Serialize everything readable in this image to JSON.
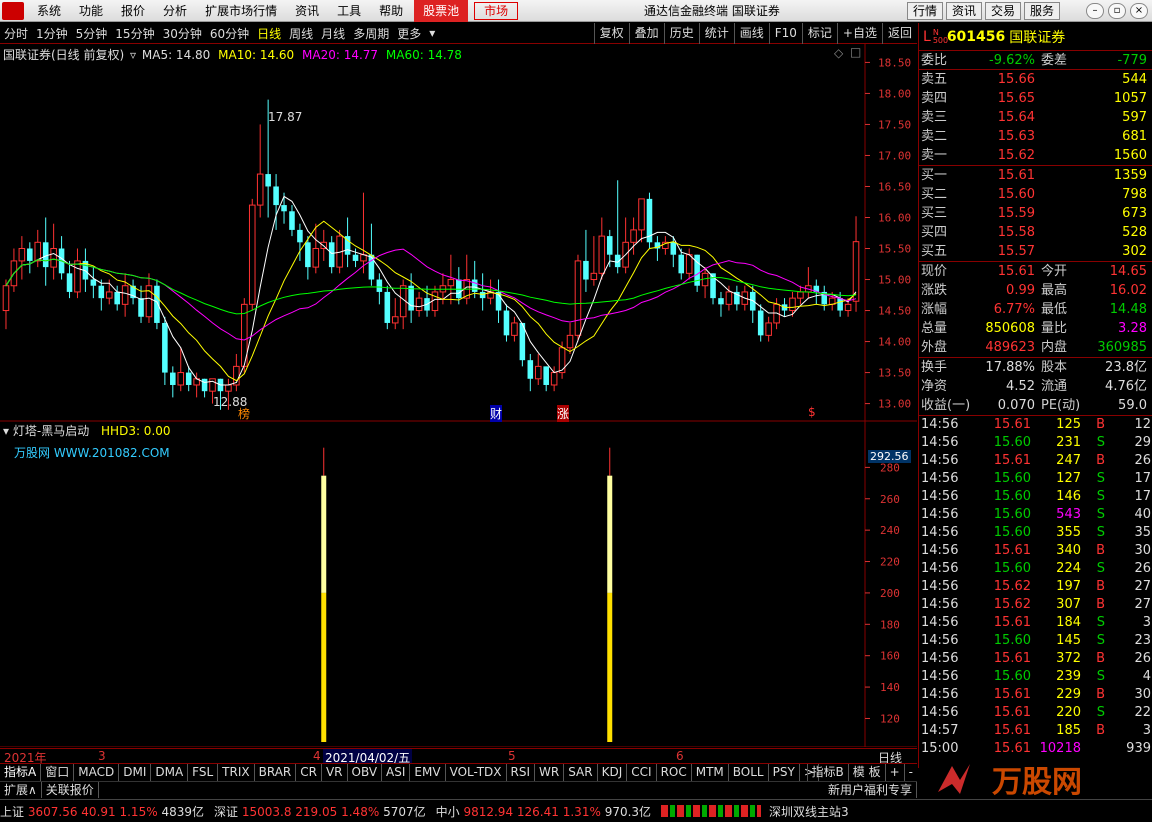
{
  "menu": [
    "系统",
    "功能",
    "报价",
    "分析",
    "扩展市场行情",
    "资讯",
    "工具",
    "帮助"
  ],
  "menu_hot": "股票池",
  "menu_market": "市场",
  "window_title": "通达信金融终端  国联证券",
  "right_buttons": [
    "行情",
    "资讯",
    "交易",
    "服务"
  ],
  "periods": [
    "分时",
    "1分钟",
    "5分钟",
    "15分钟",
    "30分钟",
    "60分钟",
    "日线",
    "周线",
    "月线",
    "多周期",
    "更多"
  ],
  "active_period": "日线",
  "tools": [
    "复权",
    "叠加",
    "历史",
    "统计",
    "画线",
    "F10",
    "标记",
    "+自选",
    "返回"
  ],
  "chart_header": {
    "name": "国联证券(日线 前复权)",
    "ma5": "MA5: 14.80",
    "ma10": "MA10: 14.60",
    "ma20": "MA20: 14.77",
    "ma60": "MA60: 14.78"
  },
  "annotations": {
    "high": "17.87",
    "low": "12.88"
  },
  "markers": [
    "榜",
    "财",
    "涨",
    "$"
  ],
  "indicator_header": {
    "name": "灯塔-黑马启动",
    "value": "HHD3: 0.00",
    "site": "万股网 WWW.201082.COM"
  },
  "indicator_current": "292.56",
  "x_labels": [
    "2021年",
    "3",
    "4",
    "5",
    "6"
  ],
  "cursor_date": "2021/04/02/五",
  "period_tag": "日线",
  "tabs": [
    "指标A",
    "窗口",
    "MACD",
    "DMI",
    "DMA",
    "FSL",
    "TRIX",
    "BRAR",
    "CR",
    "VR",
    "OBV",
    "ASI",
    "EMV",
    "VOL-TDX",
    "RSI",
    "WR",
    "SAR",
    "KDJ",
    "CCI",
    "ROC",
    "MTM",
    "BOLL",
    "PSY",
    ">"
  ],
  "tabs_right": [
    "指标B",
    "模 板",
    "+",
    "-"
  ],
  "ext_left": [
    "扩展∧",
    "关联报价"
  ],
  "ext_right": [
    "新用户福利专享"
  ],
  "stock": {
    "prefix": "L",
    "badge": "N 500",
    "code": "601456",
    "name": "国联证券"
  },
  "weibi": {
    "label": "委比",
    "value": "-9.62%",
    "label2": "委差",
    "value2": "-779"
  },
  "asks": [
    {
      "label": "卖五",
      "price": "15.66",
      "vol": "544"
    },
    {
      "label": "卖四",
      "price": "15.65",
      "vol": "1057"
    },
    {
      "label": "卖三",
      "price": "15.64",
      "vol": "597"
    },
    {
      "label": "卖二",
      "price": "15.63",
      "vol": "681"
    },
    {
      "label": "卖一",
      "price": "15.62",
      "vol": "1560"
    }
  ],
  "bids": [
    {
      "label": "买一",
      "price": "15.61",
      "vol": "1359"
    },
    {
      "label": "买二",
      "price": "15.60",
      "vol": "798"
    },
    {
      "label": "买三",
      "price": "15.59",
      "vol": "673"
    },
    {
      "label": "买四",
      "price": "15.58",
      "vol": "528"
    },
    {
      "label": "买五",
      "price": "15.57",
      "vol": "302"
    }
  ],
  "stats": [
    {
      "l1": "现价",
      "v1": "15.61",
      "l2": "今开",
      "v2": "14.65",
      "c1": "red",
      "c2": "red"
    },
    {
      "l1": "涨跌",
      "v1": "0.99",
      "l2": "最高",
      "v2": "16.02",
      "c1": "red",
      "c2": "red"
    },
    {
      "l1": "涨幅",
      "v1": "6.77%",
      "l2": "最低",
      "v2": "14.48",
      "c1": "red",
      "c2": "green"
    },
    {
      "l1": "总量",
      "v1": "850608",
      "l2": "量比",
      "v2": "3.28",
      "c1": "yellow",
      "c2": "mag"
    },
    {
      "l1": "外盘",
      "v1": "489623",
      "l2": "内盘",
      "v2": "360985",
      "c1": "red",
      "c2": "green"
    }
  ],
  "stats2": [
    {
      "l1": "换手",
      "v1": "17.88%",
      "l2": "股本",
      "v2": "23.8亿"
    },
    {
      "l1": "净资",
      "v1": "4.52",
      "l2": "流通",
      "v2": "4.76亿"
    },
    {
      "l1": "收益(一)",
      "v1": "0.070",
      "l2": "PE(动)",
      "v2": "59.0"
    }
  ],
  "ticks": [
    {
      "t": "14:56",
      "p": "15.61",
      "v": "125",
      "d": "B",
      "n": "12"
    },
    {
      "t": "14:56",
      "p": "15.60",
      "v": "231",
      "d": "S",
      "n": "29"
    },
    {
      "t": "14:56",
      "p": "15.61",
      "v": "247",
      "d": "B",
      "n": "26"
    },
    {
      "t": "14:56",
      "p": "15.60",
      "v": "127",
      "d": "S",
      "n": "17"
    },
    {
      "t": "14:56",
      "p": "15.60",
      "v": "146",
      "d": "S",
      "n": "17"
    },
    {
      "t": "14:56",
      "p": "15.60",
      "v": "543",
      "d": "S",
      "n": "40"
    },
    {
      "t": "14:56",
      "p": "15.60",
      "v": "355",
      "d": "S",
      "n": "35"
    },
    {
      "t": "14:56",
      "p": "15.61",
      "v": "340",
      "d": "B",
      "n": "30"
    },
    {
      "t": "14:56",
      "p": "15.60",
      "v": "224",
      "d": "S",
      "n": "26"
    },
    {
      "t": "14:56",
      "p": "15.62",
      "v": "197",
      "d": "B",
      "n": "27"
    },
    {
      "t": "14:56",
      "p": "15.62",
      "v": "307",
      "d": "B",
      "n": "27"
    },
    {
      "t": "14:56",
      "p": "15.61",
      "v": "184",
      "d": "S",
      "n": "3"
    },
    {
      "t": "14:56",
      "p": "15.60",
      "v": "145",
      "d": "S",
      "n": "23"
    },
    {
      "t": "14:56",
      "p": "15.61",
      "v": "372",
      "d": "B",
      "n": "26"
    },
    {
      "t": "14:56",
      "p": "15.60",
      "v": "239",
      "d": "S",
      "n": "4"
    },
    {
      "t": "14:56",
      "p": "15.61",
      "v": "229",
      "d": "B",
      "n": "30"
    },
    {
      "t": "14:56",
      "p": "15.61",
      "v": "220",
      "d": "S",
      "n": "22"
    },
    {
      "t": "14:57",
      "p": "15.61",
      "v": "185",
      "d": "B",
      "n": "3"
    },
    {
      "t": "15:00",
      "p": "15.61",
      "v": "10218",
      "d": "",
      "n": "939"
    }
  ],
  "status": [
    {
      "name": "上证",
      "v": "3607.56",
      "c": "40.91",
      "p": "1.15%",
      "a": "4839亿"
    },
    {
      "name": "深证",
      "v": "15003.8",
      "c": "219.05",
      "p": "1.48%",
      "a": "5707亿"
    },
    {
      "name": "中小",
      "v": "9812.94",
      "c": "126.41",
      "p": "1.31%",
      "a": "970.3亿"
    }
  ],
  "status_site": "深圳双线主站3",
  "watermark": "万股网",
  "chart_data": [
    {
      "type": "candlestick",
      "y_ticks": [
        13.0,
        13.5,
        14.0,
        14.5,
        15.0,
        15.5,
        16.0,
        16.5,
        17.0,
        17.5,
        18.0,
        18.5
      ],
      "ylim": [
        12.8,
        18.7
      ],
      "candles": [
        [
          14.5,
          14.9,
          14.2,
          15.0
        ],
        [
          14.9,
          15.3,
          14.8,
          15.5
        ],
        [
          15.3,
          15.5,
          15.0,
          15.7
        ],
        [
          15.5,
          15.3,
          15.1,
          15.6
        ],
        [
          15.3,
          15.6,
          15.2,
          15.8
        ],
        [
          15.6,
          15.2,
          14.9,
          16.0
        ],
        [
          15.2,
          15.5,
          15.0,
          15.9
        ],
        [
          15.5,
          15.1,
          15.0,
          15.7
        ],
        [
          15.1,
          14.8,
          14.7,
          15.3
        ],
        [
          14.8,
          15.3,
          14.7,
          15.5
        ],
        [
          15.3,
          15.0,
          14.8,
          15.5
        ],
        [
          15.0,
          14.9,
          14.7,
          15.2
        ],
        [
          14.9,
          14.7,
          14.5,
          15.0
        ],
        [
          14.7,
          14.8,
          14.6,
          15.0
        ],
        [
          14.8,
          14.6,
          14.5,
          14.9
        ],
        [
          14.6,
          14.9,
          14.4,
          15.1
        ],
        [
          14.9,
          14.7,
          14.6,
          15.0
        ],
        [
          14.7,
          14.4,
          14.3,
          14.9
        ],
        [
          14.4,
          14.9,
          14.3,
          15.1
        ],
        [
          14.9,
          14.3,
          14.2,
          15.0
        ],
        [
          14.3,
          13.5,
          13.3,
          14.4
        ],
        [
          13.5,
          13.3,
          13.1,
          13.6
        ],
        [
          13.3,
          13.5,
          13.2,
          13.9
        ],
        [
          13.5,
          13.3,
          13.2,
          13.6
        ],
        [
          13.3,
          13.4,
          13.1,
          13.5
        ],
        [
          13.4,
          13.2,
          13.1,
          13.4
        ],
        [
          13.2,
          13.4,
          13.0,
          13.4
        ],
        [
          13.4,
          13.2,
          12.9,
          13.4
        ],
        [
          13.2,
          13.3,
          12.9,
          13.4
        ],
        [
          13.3,
          13.6,
          13.2,
          13.8
        ],
        [
          13.6,
          14.6,
          13.5,
          14.7
        ],
        [
          14.6,
          16.2,
          14.5,
          16.3
        ],
        [
          16.2,
          16.7,
          16.0,
          17.5
        ],
        [
          16.7,
          16.5,
          16.0,
          17.9
        ],
        [
          16.5,
          16.2,
          15.8,
          16.7
        ],
        [
          16.2,
          16.1,
          15.9,
          16.4
        ],
        [
          16.1,
          15.8,
          15.7,
          16.2
        ],
        [
          15.8,
          15.6,
          15.3,
          15.9
        ],
        [
          15.6,
          15.2,
          15.0,
          15.7
        ],
        [
          15.2,
          15.5,
          15.1,
          15.9
        ],
        [
          15.5,
          15.6,
          15.3,
          15.8
        ],
        [
          15.6,
          15.2,
          15.1,
          15.7
        ],
        [
          15.2,
          15.7,
          15.1,
          15.8
        ],
        [
          15.7,
          15.4,
          15.2,
          16.0
        ],
        [
          15.4,
          15.3,
          15.2,
          15.5
        ],
        [
          15.3,
          15.4,
          15.1,
          16.4
        ],
        [
          15.4,
          15.0,
          14.9,
          15.9
        ],
        [
          15.0,
          14.8,
          14.6,
          15.1
        ],
        [
          14.8,
          14.3,
          14.2,
          14.9
        ],
        [
          14.3,
          14.4,
          14.2,
          14.7
        ],
        [
          14.4,
          14.9,
          14.2,
          15.0
        ],
        [
          14.9,
          14.5,
          14.3,
          15.1
        ],
        [
          14.5,
          14.7,
          14.4,
          14.8
        ],
        [
          14.7,
          14.5,
          14.4,
          14.9
        ],
        [
          14.5,
          14.8,
          14.4,
          14.9
        ],
        [
          14.8,
          14.9,
          14.6,
          15.1
        ],
        [
          14.9,
          15.0,
          14.6,
          15.4
        ],
        [
          15.0,
          14.7,
          14.6,
          15.2
        ],
        [
          14.7,
          15.0,
          14.6,
          15.4
        ],
        [
          15.0,
          14.8,
          14.7,
          15.3
        ],
        [
          14.8,
          14.7,
          14.5,
          15.1
        ],
        [
          14.7,
          14.8,
          14.6,
          15.0
        ],
        [
          14.8,
          14.5,
          14.3,
          15.0
        ],
        [
          14.5,
          14.1,
          14.0,
          14.6
        ],
        [
          14.1,
          14.3,
          14.0,
          14.4
        ],
        [
          14.3,
          13.7,
          13.6,
          14.3
        ],
        [
          13.7,
          13.4,
          13.2,
          13.8
        ],
        [
          13.4,
          13.6,
          13.3,
          13.8
        ],
        [
          13.6,
          13.3,
          13.2,
          13.6
        ],
        [
          13.3,
          13.5,
          13.2,
          13.6
        ],
        [
          13.5,
          13.9,
          13.4,
          14.0
        ],
        [
          13.9,
          14.1,
          13.8,
          14.3
        ],
        [
          14.1,
          15.3,
          14.0,
          15.4
        ],
        [
          15.3,
          15.0,
          14.8,
          15.8
        ],
        [
          15.0,
          15.1,
          14.9,
          15.7
        ],
        [
          15.1,
          15.7,
          15.0,
          16.0
        ],
        [
          15.7,
          15.4,
          15.2,
          15.8
        ],
        [
          15.4,
          15.2,
          15.1,
          16.6
        ],
        [
          15.2,
          15.6,
          15.1,
          16.0
        ],
        [
          15.6,
          15.8,
          15.4,
          16.0
        ],
        [
          15.8,
          16.3,
          15.6,
          16.3
        ],
        [
          16.3,
          15.6,
          15.5,
          16.4
        ],
        [
          15.6,
          15.5,
          15.3,
          15.7
        ],
        [
          15.5,
          15.6,
          15.4,
          15.7
        ],
        [
          15.6,
          15.4,
          15.2,
          15.7
        ],
        [
          15.4,
          15.1,
          15.0,
          15.5
        ],
        [
          15.1,
          15.4,
          15.0,
          15.5
        ],
        [
          15.4,
          14.9,
          14.8,
          15.4
        ],
        [
          14.9,
          15.1,
          14.7,
          15.2
        ],
        [
          15.1,
          14.7,
          14.6,
          15.1
        ],
        [
          14.7,
          14.6,
          14.4,
          14.8
        ],
        [
          14.6,
          14.8,
          14.5,
          14.9
        ],
        [
          14.8,
          14.6,
          14.5,
          14.9
        ],
        [
          14.6,
          14.8,
          14.5,
          14.9
        ],
        [
          14.8,
          14.5,
          14.3,
          14.9
        ],
        [
          14.5,
          14.1,
          14.0,
          14.6
        ],
        [
          14.1,
          14.3,
          14.0,
          14.4
        ],
        [
          14.3,
          14.6,
          14.2,
          14.7
        ],
        [
          14.6,
          14.5,
          14.4,
          14.7
        ],
        [
          14.5,
          14.7,
          14.4,
          14.8
        ],
        [
          14.7,
          14.8,
          14.6,
          14.9
        ],
        [
          14.8,
          14.9,
          14.7,
          15.2
        ],
        [
          14.9,
          14.8,
          14.6,
          15.0
        ],
        [
          14.8,
          14.6,
          14.5,
          14.9
        ],
        [
          14.6,
          14.7,
          14.5,
          14.8
        ],
        [
          14.7,
          14.5,
          14.4,
          14.8
        ],
        [
          14.5,
          14.6,
          14.4,
          14.7
        ],
        [
          14.65,
          15.61,
          14.48,
          16.02
        ]
      ]
    },
    {
      "type": "bar",
      "y_ticks": [
        120,
        140,
        160,
        180,
        200,
        220,
        240,
        260,
        280
      ],
      "ylim": [
        105,
        300
      ],
      "bars": [
        {
          "x_index": 40,
          "value": 292.56,
          "threshold": 200
        },
        {
          "x_index": 76,
          "value": 292.56,
          "threshold": 200
        }
      ]
    }
  ]
}
